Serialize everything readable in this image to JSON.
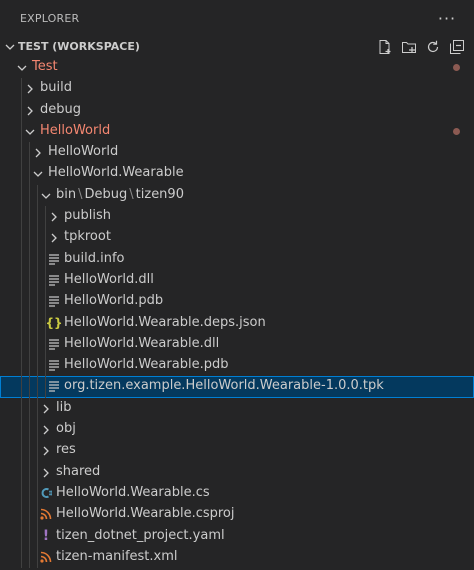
{
  "panel": {
    "title": "EXPLORER",
    "more": "···"
  },
  "workspace": {
    "title": "TEST (WORKSPACE)"
  },
  "colors": {
    "modified": "#f48771",
    "json": "#cbcb41",
    "csharp": "#519aba",
    "xml": "#e37933",
    "yaml": "#a074c4"
  },
  "tree": [
    {
      "label": "Test",
      "type": "folder",
      "open": true,
      "level": 0,
      "modified": true,
      "dot": true
    },
    {
      "label": "build",
      "type": "folder",
      "open": false,
      "level": 1
    },
    {
      "label": "debug",
      "type": "folder",
      "open": false,
      "level": 1
    },
    {
      "label": "HelloWorld",
      "type": "folder",
      "open": true,
      "level": 1,
      "modified": true,
      "dot": true
    },
    {
      "label": "HelloWorld",
      "type": "folder",
      "open": false,
      "level": 2
    },
    {
      "label": "HelloWorld.Wearable",
      "type": "folder",
      "open": true,
      "level": 2
    },
    {
      "label": "bin",
      "path": [
        "bin",
        "Debug",
        "tizen90"
      ],
      "type": "folder",
      "open": true,
      "level": 3
    },
    {
      "label": "publish",
      "type": "folder",
      "open": false,
      "level": 4
    },
    {
      "label": "tpkroot",
      "type": "folder",
      "open": false,
      "level": 4
    },
    {
      "label": "build.info",
      "type": "file",
      "icon": "lines",
      "level": 4
    },
    {
      "label": "HelloWorld.dll",
      "type": "file",
      "icon": "lines",
      "level": 4
    },
    {
      "label": "HelloWorld.pdb",
      "type": "file",
      "icon": "lines",
      "level": 4
    },
    {
      "label": "HelloWorld.Wearable.deps.json",
      "type": "file",
      "icon": "json",
      "level": 4
    },
    {
      "label": "HelloWorld.Wearable.dll",
      "type": "file",
      "icon": "lines",
      "level": 4
    },
    {
      "label": "HelloWorld.Wearable.pdb",
      "type": "file",
      "icon": "lines",
      "level": 4
    },
    {
      "label": "org.tizen.example.HelloWorld.Wearable-1.0.0.tpk",
      "type": "file",
      "icon": "lines",
      "level": 4,
      "selected": true
    },
    {
      "label": "lib",
      "type": "folder",
      "open": false,
      "level": 3
    },
    {
      "label": "obj",
      "type": "folder",
      "open": false,
      "level": 3
    },
    {
      "label": "res",
      "type": "folder",
      "open": false,
      "level": 3
    },
    {
      "label": "shared",
      "type": "folder",
      "open": false,
      "level": 3
    },
    {
      "label": "HelloWorld.Wearable.cs",
      "type": "file",
      "icon": "csharp",
      "level": 3
    },
    {
      "label": "HelloWorld.Wearable.csproj",
      "type": "file",
      "icon": "rss",
      "level": 3
    },
    {
      "label": "tizen_dotnet_project.yaml",
      "type": "file",
      "icon": "yaml",
      "level": 3
    },
    {
      "label": "tizen-manifest.xml",
      "type": "file",
      "icon": "rss",
      "level": 3
    }
  ]
}
